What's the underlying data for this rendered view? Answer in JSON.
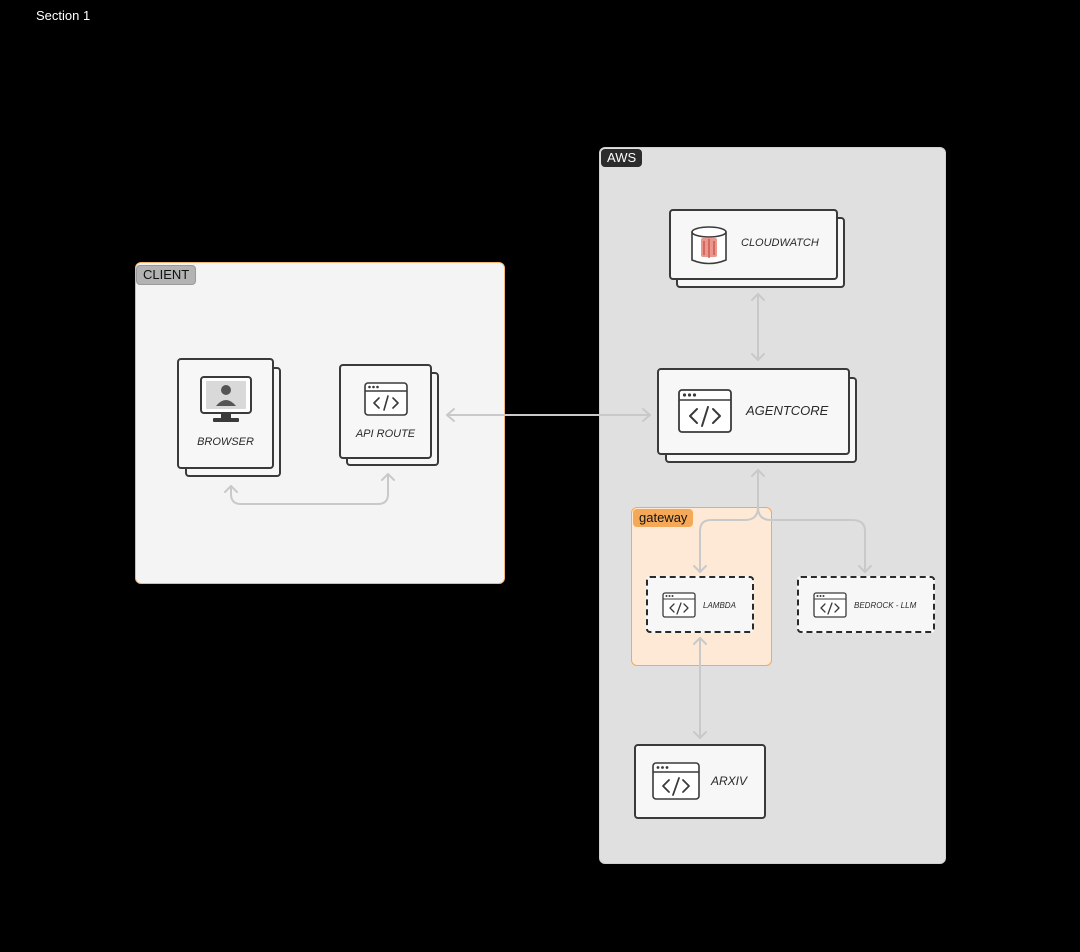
{
  "section": {
    "title": "Section 1"
  },
  "groups": {
    "client": "CLIENT",
    "aws": "AWS",
    "gateway": "gateway"
  },
  "nodes": {
    "browser": "BROWSER",
    "api_route": "API ROUTE",
    "cloudwatch": "CLOUDWATCH",
    "agentcore": "AGENTCORE",
    "lambda": "LAMBDA",
    "bedrock": "BEDROCK - LLM",
    "arxiv": "ARXIV"
  },
  "icons": {
    "browser": "desktop-user-icon",
    "api_route": "code-window-icon",
    "cloudwatch": "database-cylinder-icon",
    "agentcore": "code-window-icon",
    "lambda": "code-window-icon",
    "bedrock": "code-window-icon",
    "arxiv": "code-window-icon"
  },
  "colors": {
    "background": "#000000",
    "client_group": "#f4f4f4",
    "aws_group": "#e0e0e0",
    "gateway_group": "#fde9d6",
    "gateway_accent": "#f5a857",
    "connector": "#c9c9c9",
    "cloudwatch_accent": "#e8857a"
  }
}
